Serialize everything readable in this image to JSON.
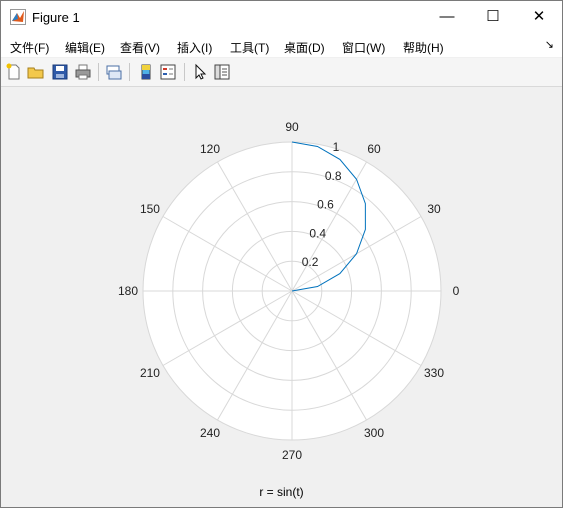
{
  "window": {
    "title": "Figure 1",
    "minimize_glyph": "—",
    "maximize_glyph": "☐",
    "close_glyph": "✕"
  },
  "menu": {
    "items": [
      {
        "label": "文件(F)"
      },
      {
        "label": "编辑(E)"
      },
      {
        "label": "查看(V)"
      },
      {
        "label": "插入(I)"
      },
      {
        "label": "工具(T)"
      },
      {
        "label": "桌面(D)"
      },
      {
        "label": "窗口(W)"
      },
      {
        "label": "帮助(H)"
      }
    ],
    "overflow_glyph": "↘"
  },
  "toolbar": {
    "tools": [
      "new-figure-icon",
      "open-file-icon",
      "save-icon",
      "print-icon",
      "link-plot-icon",
      "colorbar-icon",
      "legend-icon",
      "select-pointer-icon",
      "property-editor-icon"
    ]
  },
  "colors": {
    "line": "#0072bd",
    "grid": "#d8d8d8",
    "axes_bg": "#ffffff",
    "figure_bg": "#f0f0f0"
  },
  "chart_data": {
    "type": "polar-line",
    "theta_ticks": [
      "0",
      "30",
      "60",
      "90",
      "120",
      "150",
      "180",
      "210",
      "240",
      "270",
      "300",
      "330"
    ],
    "r_ticks": [
      "0.2",
      "0.4",
      "0.6",
      "0.8",
      "1"
    ],
    "rlim": [
      0,
      1
    ],
    "theta_range_deg": [
      0,
      90
    ],
    "series": [
      {
        "color": "#0072bd",
        "theta_deg": [
          0,
          10,
          20,
          30,
          40,
          50,
          60,
          70,
          80,
          90
        ],
        "r": [
          0,
          0.174,
          0.342,
          0.5,
          0.643,
          0.766,
          0.866,
          0.94,
          0.985,
          1.0
        ]
      }
    ],
    "grid": true,
    "title": "r = sin(t)"
  }
}
